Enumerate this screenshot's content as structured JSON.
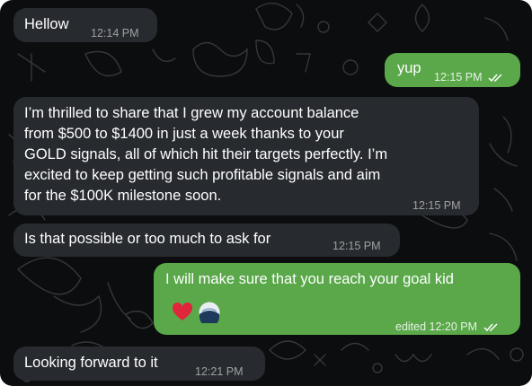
{
  "colors": {
    "background": "#0c0d0f",
    "incoming_bubble": "#272a2f",
    "outgoing_bubble": "#5aa84a",
    "text": "#ffffff"
  },
  "messages": [
    {
      "direction": "incoming",
      "text": "Hellow",
      "time": "12:14 PM"
    },
    {
      "direction": "outgoing",
      "text": "yup",
      "time": "12:15 PM",
      "status": "read"
    },
    {
      "direction": "incoming",
      "lines": [
        "I’m thrilled to share that I grew my account balance",
        "from $500 to $1400 in just a week thanks to your",
        "GOLD  signals, all of which hit their targets perfectly. I’m",
        "excited to keep getting such profitable signals and aim",
        "for the $100K milestone soon."
      ],
      "time": "12:15 PM"
    },
    {
      "direction": "incoming",
      "text": "Is that possible or too much to ask for",
      "time": "12:15 PM"
    },
    {
      "direction": "outgoing",
      "text": "I will make sure that you reach your goal kid",
      "time": "edited 12:20 PM",
      "status": "read",
      "reactions": [
        "heart-icon",
        "avatar"
      ]
    },
    {
      "direction": "incoming",
      "text": "Looking forward to it",
      "time": "12:21 PM"
    }
  ]
}
